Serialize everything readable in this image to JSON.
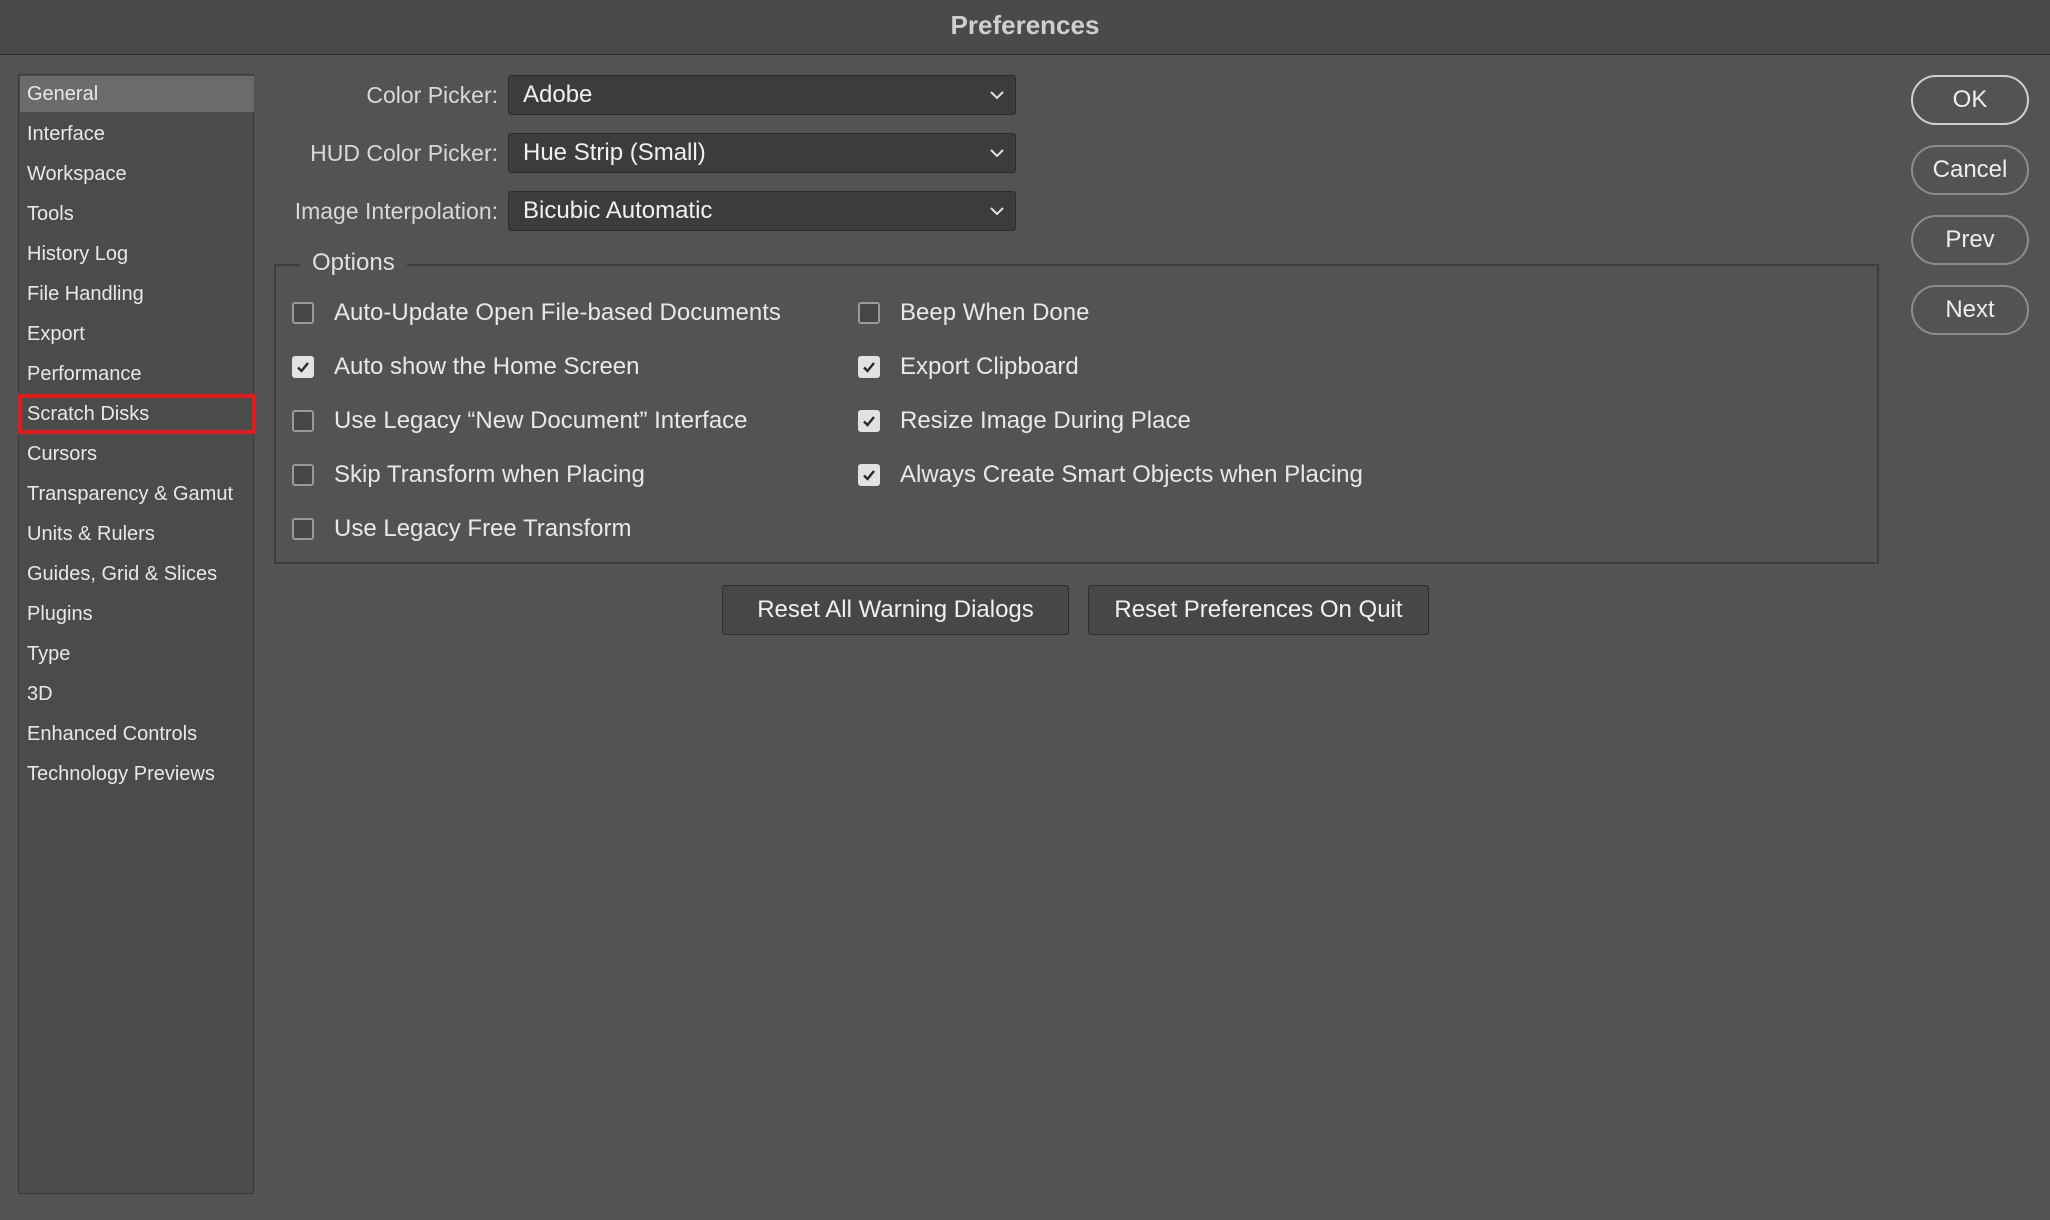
{
  "window": {
    "title": "Preferences"
  },
  "sidebar": {
    "items": [
      {
        "label": "General"
      },
      {
        "label": "Interface"
      },
      {
        "label": "Workspace"
      },
      {
        "label": "Tools"
      },
      {
        "label": "History Log"
      },
      {
        "label": "File Handling"
      },
      {
        "label": "Export"
      },
      {
        "label": "Performance"
      },
      {
        "label": "Scratch Disks"
      },
      {
        "label": "Cursors"
      },
      {
        "label": "Transparency & Gamut"
      },
      {
        "label": "Units & Rulers"
      },
      {
        "label": "Guides, Grid & Slices"
      },
      {
        "label": "Plugins"
      },
      {
        "label": "Type"
      },
      {
        "label": "3D"
      },
      {
        "label": "Enhanced Controls"
      },
      {
        "label": "Technology Previews"
      }
    ],
    "selected": "General",
    "highlighted": "Scratch Disks",
    "highlight_color": "#e01b1b"
  },
  "form": {
    "color_picker": {
      "label": "Color Picker:",
      "value": "Adobe"
    },
    "hud_color_picker": {
      "label": "HUD Color Picker:",
      "value": "Hue Strip (Small)"
    },
    "image_interpolation": {
      "label": "Image Interpolation:",
      "value": "Bicubic Automatic"
    }
  },
  "options": {
    "title": "Options",
    "left": [
      {
        "label": "Auto-Update Open File-based Documents",
        "checked": false
      },
      {
        "label": "Auto show the Home Screen",
        "checked": true
      },
      {
        "label": "Use Legacy “New Document” Interface",
        "checked": false
      },
      {
        "label": "Skip Transform when Placing",
        "checked": false
      },
      {
        "label": "Use Legacy Free Transform",
        "checked": false
      }
    ],
    "right": [
      {
        "label": "Beep When Done",
        "checked": false
      },
      {
        "label": "Export Clipboard",
        "checked": true
      },
      {
        "label": "Resize Image During Place",
        "checked": true
      },
      {
        "label": "Always Create Smart Objects when Placing",
        "checked": true
      }
    ]
  },
  "buttons": {
    "reset_warnings": "Reset All Warning Dialogs",
    "reset_prefs": "Reset Preferences On Quit"
  },
  "actions": {
    "ok": "OK",
    "cancel": "Cancel",
    "prev": "Prev",
    "next": "Next"
  }
}
